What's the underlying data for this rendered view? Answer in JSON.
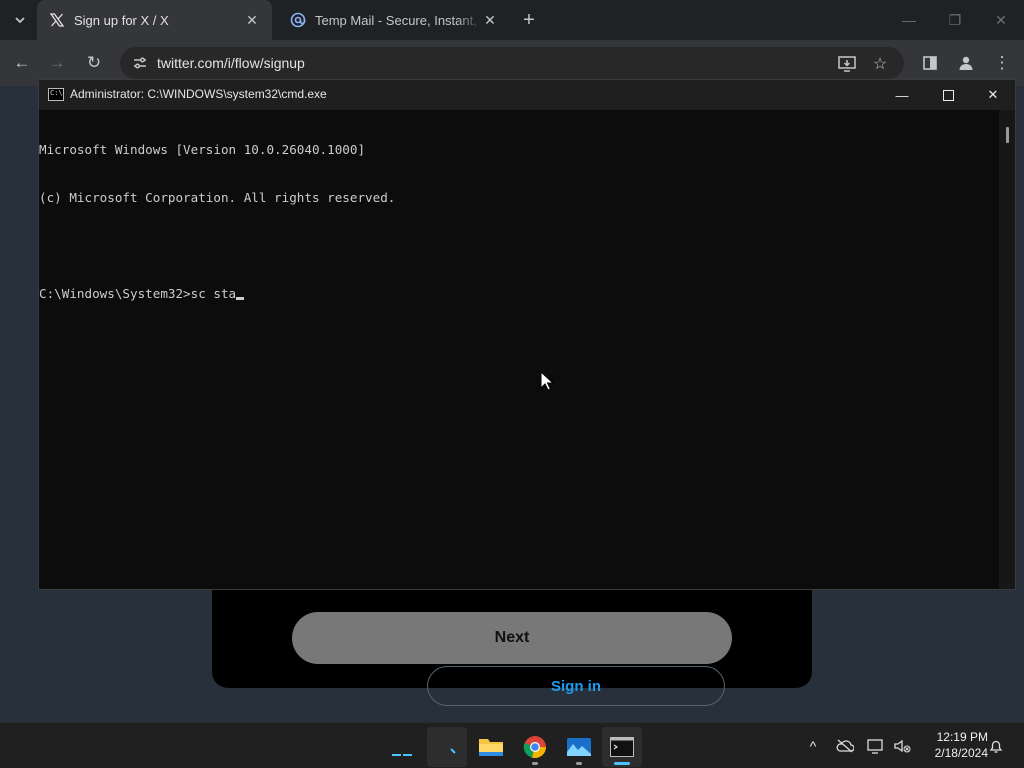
{
  "browser": {
    "tabs": [
      {
        "title": "Sign up for X / X",
        "favicon": "x-logo-icon",
        "active": true
      },
      {
        "title": "Temp Mail - Secure, Instant, Fast",
        "favicon": "temp-mail-icon",
        "active": false
      }
    ],
    "url": "twitter.com/i/flow/signup"
  },
  "page": {
    "next_label": "Next",
    "signin_label": "Sign in"
  },
  "cmd": {
    "title": "Administrator: C:\\WINDOWS\\system32\\cmd.exe",
    "icon_text": "C:\\",
    "lines": [
      "Microsoft Windows [Version 10.0.26040.1000]",
      "(c) Microsoft Corporation. All rights reserved.",
      "",
      "C:\\Windows\\System32>sc sta"
    ]
  },
  "taskbar": {
    "time": "12:19 PM",
    "date": "2/18/2024"
  },
  "colors": {
    "cmd_bg": "#0c0c0c",
    "cmd_text": "#cccccc",
    "accent": "#4cc2ff",
    "twitter_blue": "#1d9bf0"
  }
}
